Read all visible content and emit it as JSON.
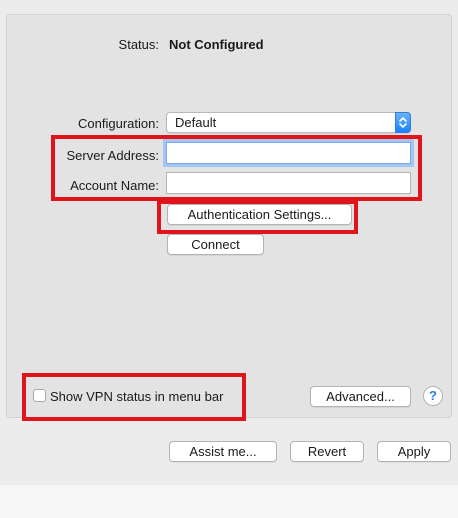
{
  "status": {
    "label": "Status:",
    "value": "Not Configured"
  },
  "configuration": {
    "label": "Configuration:",
    "selected": "Default"
  },
  "server_address": {
    "label": "Server Address:",
    "value": ""
  },
  "account_name": {
    "label": "Account Name:",
    "value": ""
  },
  "buttons": {
    "authentication_settings": "Authentication Settings...",
    "connect": "Connect",
    "advanced": "Advanced...",
    "help": "?",
    "assist_me": "Assist me...",
    "revert": "Revert",
    "apply": "Apply"
  },
  "menu_bar_checkbox": {
    "label": "Show VPN status in menu bar",
    "checked": false
  },
  "icons": {
    "stepper": "popup-stepper-icon",
    "help": "help-icon"
  },
  "colors": {
    "accent": "#1a82fb",
    "highlight_box": "#e0141b",
    "focus_ring": "#a3c6f5"
  }
}
